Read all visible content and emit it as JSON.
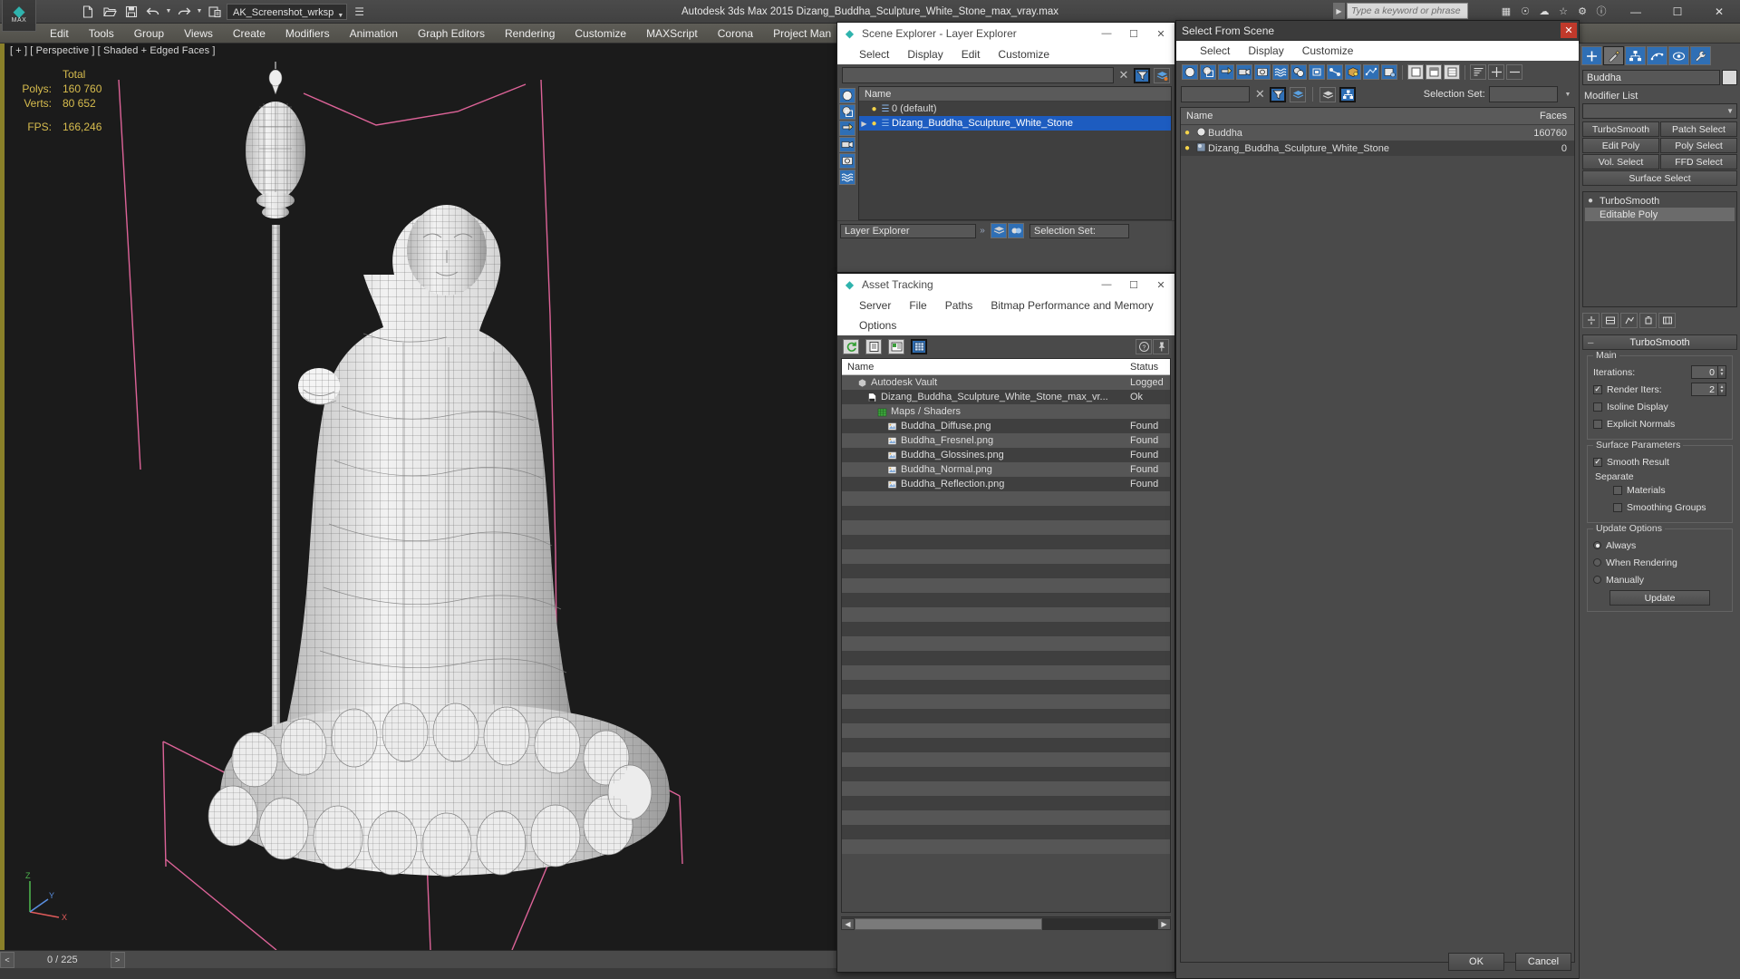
{
  "titlebar": {
    "app_logo": "max-logo",
    "logo_label": "MAX",
    "workspace": "AK_Screenshot_wrksp",
    "app_title": "Autodesk 3ds Max  2015    Dizang_Buddha_Sculpture_White_Stone_max_vray.max",
    "search_placeholder": "Type a keyword or phrase",
    "minimize": "—",
    "maximize": "☐",
    "close": "✕",
    "quick_access": [
      "new-file-icon",
      "open-file-icon",
      "save-file-icon",
      "undo-icon",
      "redo-icon",
      "set-project-folder-icon"
    ]
  },
  "menubar": {
    "items": [
      "Edit",
      "Tools",
      "Group",
      "Views",
      "Create",
      "Modifiers",
      "Animation",
      "Graph Editors",
      "Rendering",
      "Customize",
      "MAXScript",
      "Corona",
      "Project Man"
    ]
  },
  "viewport": {
    "label": "[ + ] [ Perspective ] [ Shaded + Edged Faces ]",
    "stats": {
      "header": "Total",
      "rows": [
        {
          "key": "Polys:",
          "value": "160 760"
        },
        {
          "key": "Verts:",
          "value": "80 652"
        }
      ],
      "fps_key": "FPS:",
      "fps_value": "166,246"
    },
    "axis": {
      "z": "Z",
      "y": "Y",
      "x": "X"
    }
  },
  "timebar": {
    "prev": "<",
    "next": ">",
    "frame": "0 / 225"
  },
  "scene_explorer": {
    "title": "Scene Explorer - Layer Explorer",
    "icon": "max-window-icon",
    "minimize": "—",
    "maximize": "☐",
    "close": "✕",
    "menu": [
      "Select",
      "Display",
      "Edit",
      "Customize"
    ],
    "search_value": "",
    "clear_icon": "clear-x-icon",
    "filter_icon": "filter-icon",
    "layer_icon": "layers-icon",
    "side_tools": [
      "geometry-filter-icon",
      "shapes-filter-icon",
      "lights-filter-icon",
      "cameras-filter-icon",
      "helpers-filter-icon",
      "spacewarps-filter-icon"
    ],
    "column_name": "Name",
    "rows": [
      {
        "name": "0 (default)",
        "selected": false,
        "expandable": false
      },
      {
        "name": "Dizang_Buddha_Sculpture_White_Stone",
        "selected": true,
        "expandable": true
      }
    ],
    "footer_tab": "Layer Explorer",
    "footer_chevron": "»",
    "selection_set_label": "Selection Set:",
    "footer_icons": [
      "layer-manage-icon",
      "layer-props-icon"
    ]
  },
  "asset_tracking": {
    "title": "Asset Tracking",
    "icon": "max-window-icon",
    "minimize": "—",
    "maximize": "☐",
    "close": "✕",
    "menu_row1": [
      "Server",
      "File",
      "Paths",
      "Bitmap Performance and Memory"
    ],
    "menu_row2": [
      "Options"
    ],
    "toolbar_icons": [
      "refresh-icon",
      "list-view-icon",
      "thumbnail-view-icon",
      "grid-view-icon"
    ],
    "toolbar_right_icons": [
      "help-icon",
      "pin-icon"
    ],
    "columns": [
      "Name",
      "Status"
    ],
    "rows": [
      {
        "name": "Autodesk Vault",
        "status": "Logged",
        "icon": "vault-icon",
        "indent": 1
      },
      {
        "name": "Dizang_Buddha_Sculpture_White_Stone_max_vr...",
        "status": "Ok",
        "icon": "max-file-icon",
        "indent": 2
      },
      {
        "name": "Maps / Shaders",
        "status": "",
        "icon": "maps-folder-icon",
        "indent": 3
      },
      {
        "name": "Buddha_Diffuse.png",
        "status": "Found",
        "icon": "bitmap-icon",
        "indent": 4
      },
      {
        "name": "Buddha_Fresnel.png",
        "status": "Found",
        "icon": "bitmap-icon",
        "indent": 4
      },
      {
        "name": "Buddha_Glossines.png",
        "status": "Found",
        "icon": "bitmap-icon",
        "indent": 4
      },
      {
        "name": "Buddha_Normal.png",
        "status": "Found",
        "icon": "bitmap-icon",
        "indent": 4
      },
      {
        "name": "Buddha_Reflection.png",
        "status": "Found",
        "icon": "bitmap-icon",
        "indent": 4
      }
    ],
    "empty_row_count": 25,
    "scroll_left": "◀",
    "scroll_right": "▶"
  },
  "select_from_scene": {
    "title": "Select From Scene",
    "close": "✕",
    "menu": [
      "Select",
      "Display",
      "Customize"
    ],
    "search_value": "",
    "clear_icon": "clear-x-icon",
    "filter_icon": "filter-icon",
    "layers_icon": "layers-icon",
    "hierarchy_icon": "hierarchy-icon",
    "selection_set_label": "Selection Set:",
    "selection_set_value": "",
    "filter_icons": [
      "geometry-filter-icon",
      "shapes-filter-icon",
      "lights-filter-icon",
      "cameras-filter-icon",
      "helpers-filter-icon",
      "spacewarps-filter-icon",
      "groups-filter-icon",
      "xrefs-filter-icon",
      "bones-filter-icon",
      "containers-filter-icon",
      "particles-filter-icon",
      "all-filter-icon",
      "none-filter-icon",
      "invert-filter-icon"
    ],
    "view_icons": [
      "display-none-icon",
      "display-partial-icon",
      "display-all-icon",
      "sort-icon",
      "expand-icon",
      "collapse-icon"
    ],
    "columns": [
      "Name",
      "Faces"
    ],
    "rows": [
      {
        "name": "Buddha",
        "faces": "160760",
        "icon": "geometry-object-icon",
        "selected": false
      },
      {
        "name": "Dizang_Buddha_Sculpture_White_Stone",
        "faces": "0",
        "icon": "layer-object-icon",
        "selected": false
      }
    ],
    "ok_label": "OK",
    "cancel_label": "Cancel"
  },
  "command_panel": {
    "tabs": [
      "create-tab-icon",
      "modify-tab-icon",
      "hierarchy-tab-icon",
      "motion-tab-icon",
      "display-tab-icon",
      "utilities-tab-icon"
    ],
    "object_name": "Buddha",
    "color_swatch": "#d9d9d9",
    "modifier_list_label": "Modifier List",
    "modifier_buttons": [
      "TurboSmooth",
      "Patch Select",
      "Edit Poly",
      "Poly Select",
      "Vol. Select",
      "FFD Select"
    ],
    "surface_select_label": "Surface Select",
    "stack": [
      {
        "name": "TurboSmooth",
        "selected": false,
        "eye": "●"
      },
      {
        "name": "Editable Poly",
        "selected": true,
        "eye": ""
      }
    ],
    "stack_buttons": [
      "pin-stack-icon",
      "show-end-result-icon",
      "make-unique-icon",
      "remove-modifier-icon",
      "configure-sets-icon"
    ],
    "rollout": {
      "title": "TurboSmooth",
      "main_group": "Main",
      "iterations_label": "Iterations:",
      "iterations_value": "0",
      "render_iters_label": "Render Iters:",
      "render_iters_value": "2",
      "render_iters_checked": true,
      "isoline_label": "Isoline Display",
      "isoline_checked": false,
      "explicit_normals_label": "Explicit Normals",
      "explicit_normals_checked": false,
      "surface_params_group": "Surface Parameters",
      "smooth_result_label": "Smooth Result",
      "smooth_result_checked": true,
      "separate_label": "Separate",
      "materials_label": "Materials",
      "materials_checked": false,
      "smoothing_groups_label": "Smoothing Groups",
      "smoothing_groups_checked": false,
      "update_options_group": "Update Options",
      "update_mode": "Always",
      "update_options": [
        "Always",
        "When Rendering",
        "Manually"
      ],
      "update_button": "Update"
    }
  }
}
